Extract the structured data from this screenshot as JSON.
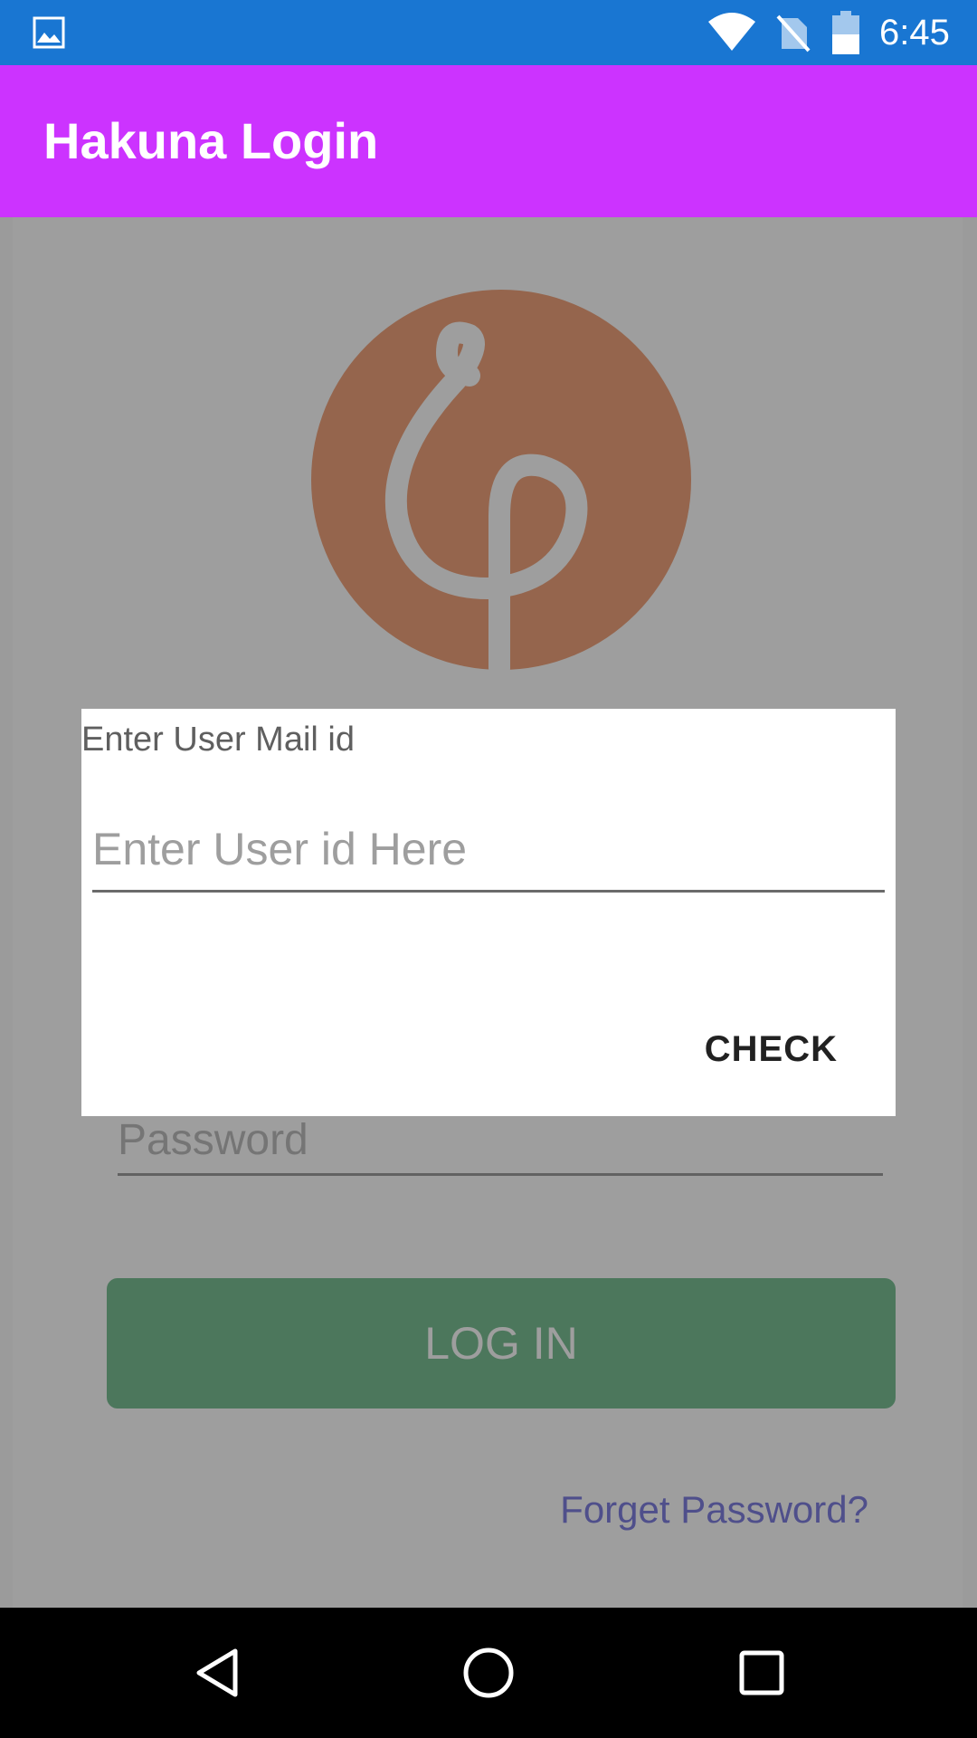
{
  "status_bar": {
    "time": "6:45",
    "icons": [
      "gallery-icon",
      "wifi-icon",
      "no-sim-icon",
      "battery-icon"
    ]
  },
  "app_bar": {
    "title": "Hakuna Login"
  },
  "login": {
    "password_placeholder": "Password",
    "login_label": "LOG IN",
    "forget_label": "Forget Password?"
  },
  "dialog": {
    "title": "Enter User Mail id",
    "input_placeholder": "Enter User id Here",
    "check_label": "CHECK"
  },
  "nav_bar": {
    "icons": [
      "back-icon",
      "home-icon",
      "recents-icon"
    ]
  },
  "colors": {
    "status_bar": "#1976d2",
    "app_bar": "#cc33ff",
    "login_button": "#7bc095",
    "logo": "#f0a47c",
    "link": "#8080e0"
  }
}
